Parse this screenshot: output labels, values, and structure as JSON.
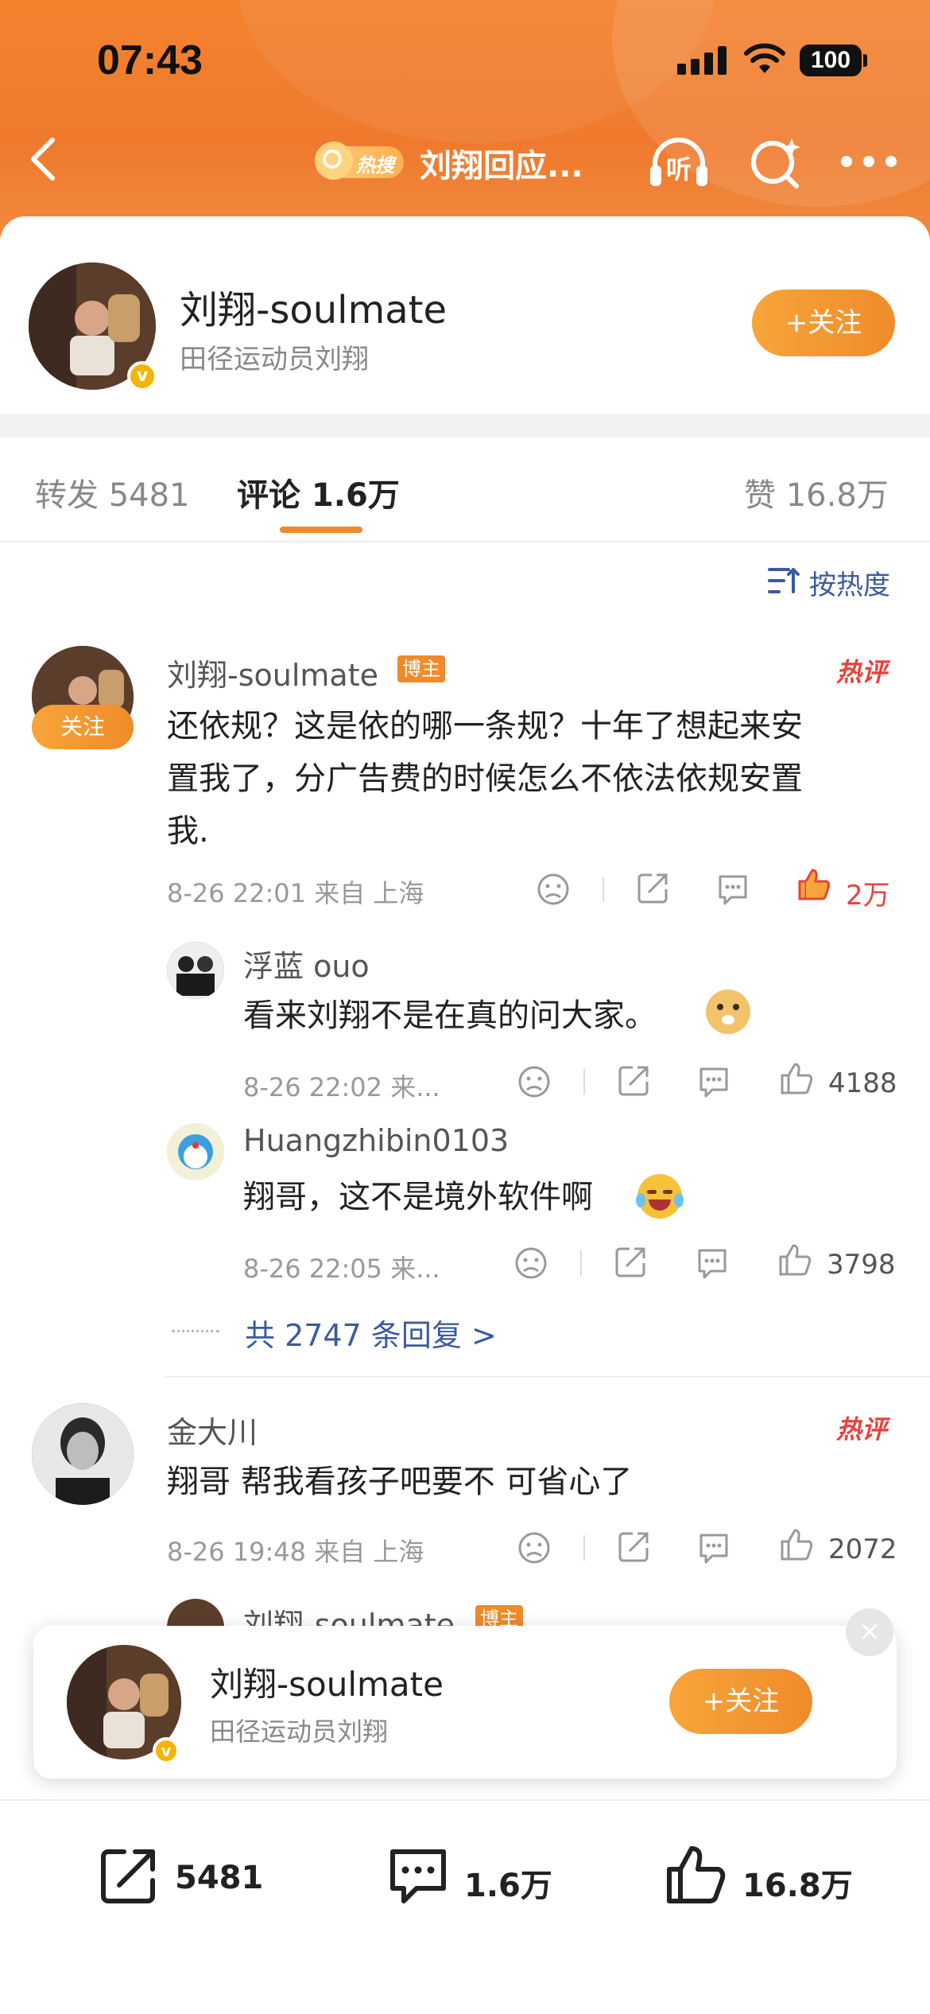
{
  "status_bar": {
    "time": "07:43",
    "battery": "100"
  },
  "nav": {
    "hot_badge": "热搜",
    "title": "刘翔回应...",
    "listen_label": "听"
  },
  "profile": {
    "name": "刘翔-soulmate",
    "subtitle": "田径运动员刘翔",
    "follow": "+关注"
  },
  "tabs": {
    "repost": "转发 5481",
    "comment": "评论 1.6万",
    "like": "赞 16.8万"
  },
  "sort_label": "按热度",
  "comments": [
    {
      "name": "刘翔-soulmate",
      "host_tag": "博主",
      "hot_tag": "热评",
      "follow": "关注",
      "text_lines": [
        "还依规？这是依的哪一条规？十年了想起来安",
        "置我了，分广告费的时候怎么不依法依规安置",
        "我."
      ],
      "meta": "8-26 22:01 来自 上海",
      "likes": "2万",
      "replies": [
        {
          "name": "浮蓝 ouo",
          "text": "看来刘翔不是在真的问大家。",
          "meta": "8-26 22:02 来...",
          "likes": "4188"
        },
        {
          "name": "Huangzhibin0103",
          "text": "翔哥，这不是境外软件啊",
          "meta": "8-26 22:05 来...",
          "likes": "3798"
        }
      ],
      "more_replies": "共 2747 条回复 >"
    },
    {
      "name": "金大川",
      "hot_tag": "热评",
      "text": "翔哥 帮我看孩子吧要不 可省心了",
      "meta": "8-26 19:48 来自 上海",
      "likes": "2072",
      "reply_partial": {
        "name": "刘翔-soulmate",
        "host_tag": "博主"
      }
    }
  ],
  "float_card": {
    "name": "刘翔-soulmate",
    "subtitle": "田径运动员刘翔",
    "follow": "+关注",
    "close": "×"
  },
  "bottom_bar": {
    "repost": "5481",
    "comment": "1.6万",
    "like": "16.8万"
  },
  "colors": {
    "accent": "#f08a2a",
    "link": "#3b5aa0",
    "hot": "#e8413c",
    "header": "#f3822e"
  }
}
